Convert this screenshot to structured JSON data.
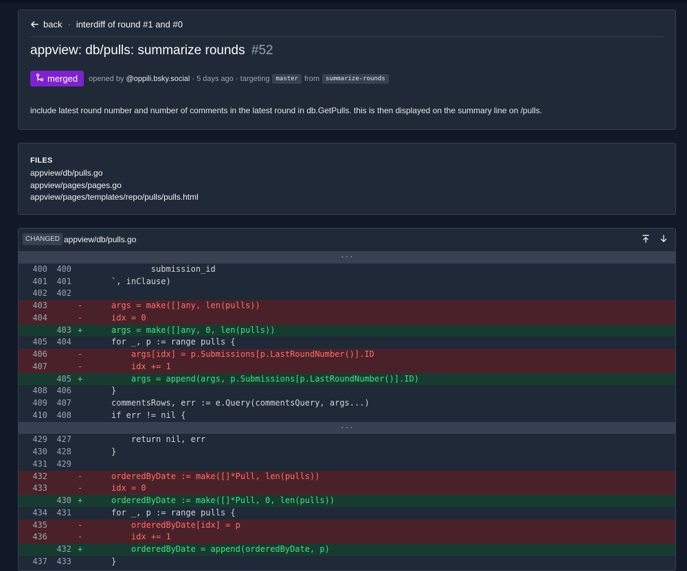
{
  "header": {
    "back_label": "back",
    "crumb": "interdiff of round #1 and #0",
    "title": "appview: db/pulls: summarize rounds",
    "number": "#52",
    "status": "merged",
    "opened_by_prefix": "opened by",
    "author": "@oppili.bsky.social",
    "age": "· 5 days ago · targeting",
    "target_branch": "master",
    "from_label": "from",
    "source_branch": "summarize-rounds",
    "description": "include latest round number and number of comments in the latest round in db.GetPulls. this is then displayed on the summary line on /pulls.",
    "status_color": "#7e22ce"
  },
  "files": {
    "label": "FILES",
    "items": [
      "appview/db/pulls.go",
      "appview/pages/pages.go",
      "appview/pages/templates/repo/pulls/pulls.html"
    ]
  },
  "diff": {
    "badge": "CHANGED",
    "file": "appview/db/pulls.go",
    "rows": [
      {
        "t": "sep",
        "code": "···"
      },
      {
        "t": "ctx",
        "a": "400",
        "b": "400",
        "code": "        submission_id"
      },
      {
        "t": "ctx",
        "a": "401",
        "b": "401",
        "code": "`, inClause)"
      },
      {
        "t": "ctx",
        "a": "402",
        "b": "402",
        "code": ""
      },
      {
        "t": "del",
        "a": "403",
        "b": "",
        "s": "-",
        "code": "args = make([]any, len(pulls))"
      },
      {
        "t": "del",
        "a": "404",
        "b": "",
        "s": "-",
        "code": "idx = 0"
      },
      {
        "t": "add",
        "a": "",
        "b": "403",
        "s": "+",
        "code": "args = make([]any, 0, len(pulls))"
      },
      {
        "t": "ctx",
        "a": "405",
        "b": "404",
        "code": "for _, p := range pulls {"
      },
      {
        "t": "del",
        "a": "406",
        "b": "",
        "s": "-",
        "code": "    args[idx] = p.Submissions[p.LastRoundNumber()].ID"
      },
      {
        "t": "del",
        "a": "407",
        "b": "",
        "s": "-",
        "code": "    idx += 1"
      },
      {
        "t": "add",
        "a": "",
        "b": "405",
        "s": "+",
        "code": "    args = append(args, p.Submissions[p.LastRoundNumber()].ID)"
      },
      {
        "t": "ctx",
        "a": "408",
        "b": "406",
        "code": "}"
      },
      {
        "t": "ctx",
        "a": "409",
        "b": "407",
        "code": "commentsRows, err := e.Query(commentsQuery, args...)"
      },
      {
        "t": "ctx",
        "a": "410",
        "b": "408",
        "code": "if err != nil {"
      },
      {
        "t": "sep",
        "code": "···"
      },
      {
        "t": "ctx",
        "a": "429",
        "b": "427",
        "code": "    return nil, err"
      },
      {
        "t": "ctx",
        "a": "430",
        "b": "428",
        "code": "}"
      },
      {
        "t": "ctx",
        "a": "431",
        "b": "429",
        "code": ""
      },
      {
        "t": "del",
        "a": "432",
        "b": "",
        "s": "-",
        "code": "orderedByDate := make([]*Pull, len(pulls))"
      },
      {
        "t": "del",
        "a": "433",
        "b": "",
        "s": "-",
        "code": "idx = 0"
      },
      {
        "t": "add",
        "a": "",
        "b": "430",
        "s": "+",
        "code": "orderedByDate := make([]*Pull, 0, len(pulls))"
      },
      {
        "t": "ctx",
        "a": "434",
        "b": "431",
        "code": "for _, p := range pulls {"
      },
      {
        "t": "del",
        "a": "435",
        "b": "",
        "s": "-",
        "code": "    orderedByDate[idx] = p"
      },
      {
        "t": "del",
        "a": "436",
        "b": "",
        "s": "-",
        "code": "    idx += 1"
      },
      {
        "t": "add",
        "a": "",
        "b": "432",
        "s": "+",
        "code": "    orderedByDate = append(orderedByDate, p)"
      },
      {
        "t": "ctx",
        "a": "437",
        "b": "433",
        "code": "}"
      }
    ]
  }
}
